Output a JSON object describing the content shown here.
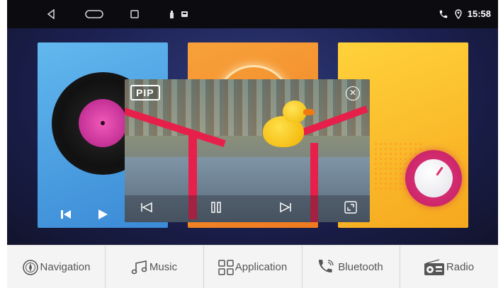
{
  "status": {
    "time": "15:58",
    "icons": [
      "back-icon",
      "home-icon",
      "recents-icon",
      "usb-icon",
      "sd-card-icon",
      "phone-icon",
      "location-icon"
    ]
  },
  "cards": {
    "music": {
      "controls": [
        "previous-icon",
        "play-icon"
      ],
      "color": "#4ea3e6"
    },
    "video": {
      "color": "#f4922c"
    },
    "radio": {
      "color": "#fbc12f"
    }
  },
  "pip": {
    "label": "PIP",
    "controls": [
      "previous-icon",
      "pause-icon",
      "next-icon",
      "fullscreen-icon"
    ]
  },
  "dock": {
    "items": [
      {
        "label": "Navigation",
        "icon": "navigation-icon"
      },
      {
        "label": "Music",
        "icon": "music-note-icon"
      },
      {
        "label": "Application",
        "icon": "apps-grid-icon"
      },
      {
        "label": "Bluetooth",
        "icon": "bluetooth-phone-icon"
      },
      {
        "label": "Radio",
        "icon": "radio-icon"
      }
    ]
  },
  "colors": {
    "accent_pink": "#e0306f",
    "statusbar": "#0b0b10",
    "dock": "#f4f4f4"
  }
}
